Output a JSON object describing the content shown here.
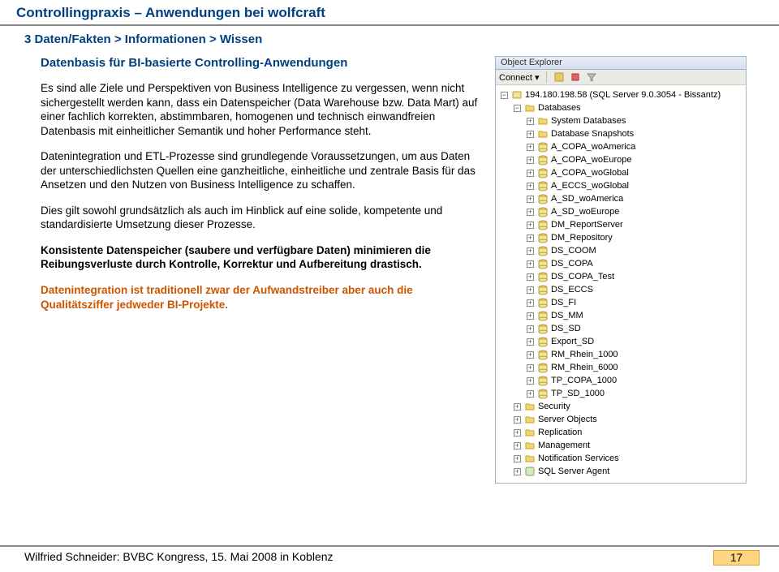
{
  "header": {
    "title": "Controllingpraxis – Anwendungen bei wolfcraft",
    "breadcrumb": "3  Daten/Fakten > Informationen > Wissen"
  },
  "section": {
    "title": "Datenbasis für BI-basierte Controlling-Anwendungen",
    "p1": "Es sind alle Ziele und Perspektiven von Business Intelligence zu vergessen, wenn nicht sichergestellt werden kann, dass ein Datenspeicher (Data Warehouse bzw. Data Mart) auf einer fachlich korrekten, abstimmbaren, homogenen und technisch einwandfreien Datenbasis mit einheitlicher Semantik und hoher Performance steht.",
    "p2": "Datenintegration und ETL-Prozesse sind grundlegende Voraussetzungen, um aus Daten der unterschiedlichsten Quellen eine ganzheitliche, einheitliche und zentrale Basis für das Ansetzen und den Nutzen von Business Intelligence zu schaffen.",
    "p3": "Dies gilt sowohl grundsätzlich als auch im Hinblick auf eine solide, kompetente und standardisierte Umsetzung dieser Prozesse.",
    "p4": "Konsistente Datenspeicher (saubere und verfügbare Daten) minimieren die Reibungsverluste durch Kontrolle, Korrektur und Aufbereitung drastisch.",
    "p5": "Datenintegration ist traditionell zwar der Aufwandstreiber aber auch die Qualitätsziffer jedweder BI-Projekte."
  },
  "explorer": {
    "title": "Object Explorer",
    "connect": "Connect ▾",
    "root": "194.180.198.58 (SQL Server 9.0.3054 - Bissantz)",
    "databases": "Databases",
    "sysdb": "System Databases",
    "snapshots": "Database Snapshots",
    "dbs": [
      "A_COPA_woAmerica",
      "A_COPA_woEurope",
      "A_COPA_woGlobal",
      "A_ECCS_woGlobal",
      "A_SD_woAmerica",
      "A_SD_woEurope",
      "DM_ReportServer",
      "DM_Repository",
      "DS_COOM",
      "DS_COPA",
      "DS_COPA_Test",
      "DS_ECCS",
      "DS_FI",
      "DS_MM",
      "DS_SD",
      "Export_SD",
      "RM_Rhein_1000",
      "RM_Rhein_6000",
      "TP_COPA_1000",
      "TP_SD_1000"
    ],
    "folders": [
      "Security",
      "Server Objects",
      "Replication",
      "Management",
      "Notification Services"
    ],
    "agent": "SQL Server Agent"
  },
  "footer": {
    "text": "Wilfried Schneider: BVBC Kongress, 15. Mai 2008 in Koblenz",
    "page": "17"
  }
}
